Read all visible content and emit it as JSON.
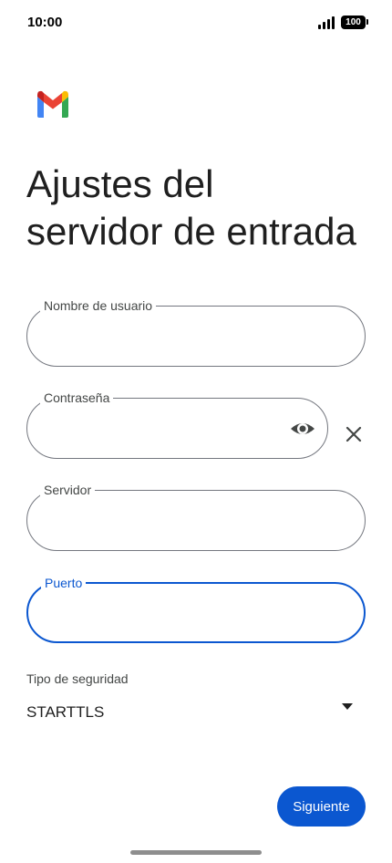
{
  "status_bar": {
    "time": "10:00",
    "battery": "100"
  },
  "app": {
    "logo_icon": "gmail-logo-icon"
  },
  "page": {
    "title_line1": "Ajustes del",
    "title_line2": "servidor de entrada"
  },
  "form": {
    "username": {
      "label": "Nombre de usuario",
      "value": ""
    },
    "password": {
      "label": "Contraseña",
      "value": "",
      "toggle_icon": "eye-icon",
      "clear_icon": "close-icon"
    },
    "server": {
      "label": "Servidor",
      "value": ""
    },
    "port": {
      "label": "Puerto",
      "value": "",
      "focused": true
    },
    "security": {
      "label": "Tipo de seguridad",
      "value": "STARTTLS",
      "arrow_icon": "dropdown-arrow-icon"
    }
  },
  "actions": {
    "next_label": "Siguiente"
  },
  "colors": {
    "accent": "#0b57d0",
    "border": "#74777f",
    "text": "#1f1f1f"
  }
}
